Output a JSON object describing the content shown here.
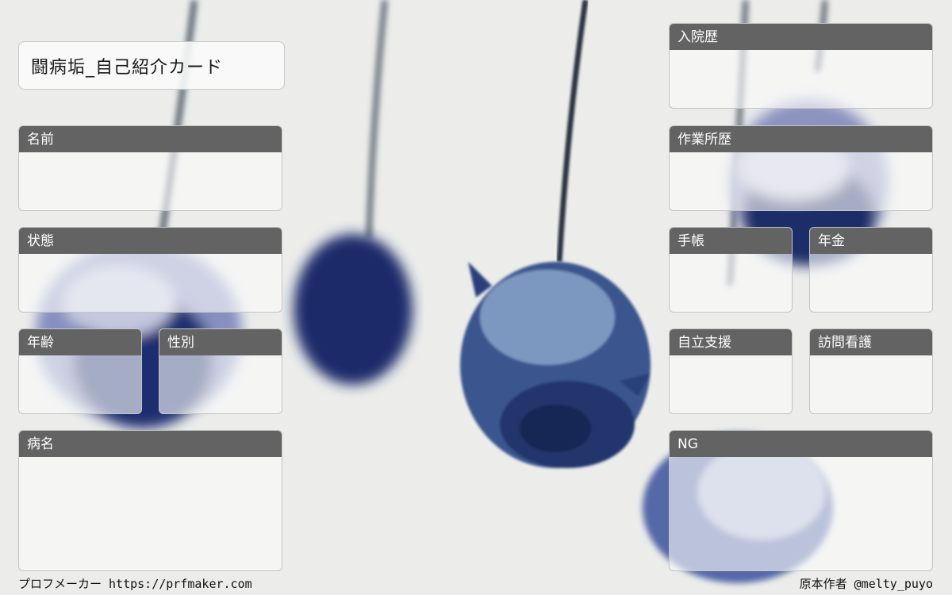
{
  "title": "闘病垢_自己紹介カード",
  "fields": {
    "name": "名前",
    "condition": "状態",
    "age": "年齢",
    "gender": "性別",
    "disease": "病名",
    "hospitalization": "入院歴",
    "workplace": "作業所歴",
    "notebook": "手帳",
    "pension": "年金",
    "support": "自立支援",
    "visit_nursing": "訪問看護",
    "ng": "NG"
  },
  "footer": {
    "left": "プロフメーカー https://prfmaker.com",
    "right": "原本作者 @melty_puyo"
  },
  "colors": {
    "header_bg": "#636363",
    "rose": "#2a3f7a",
    "background": "#ecedeb"
  }
}
